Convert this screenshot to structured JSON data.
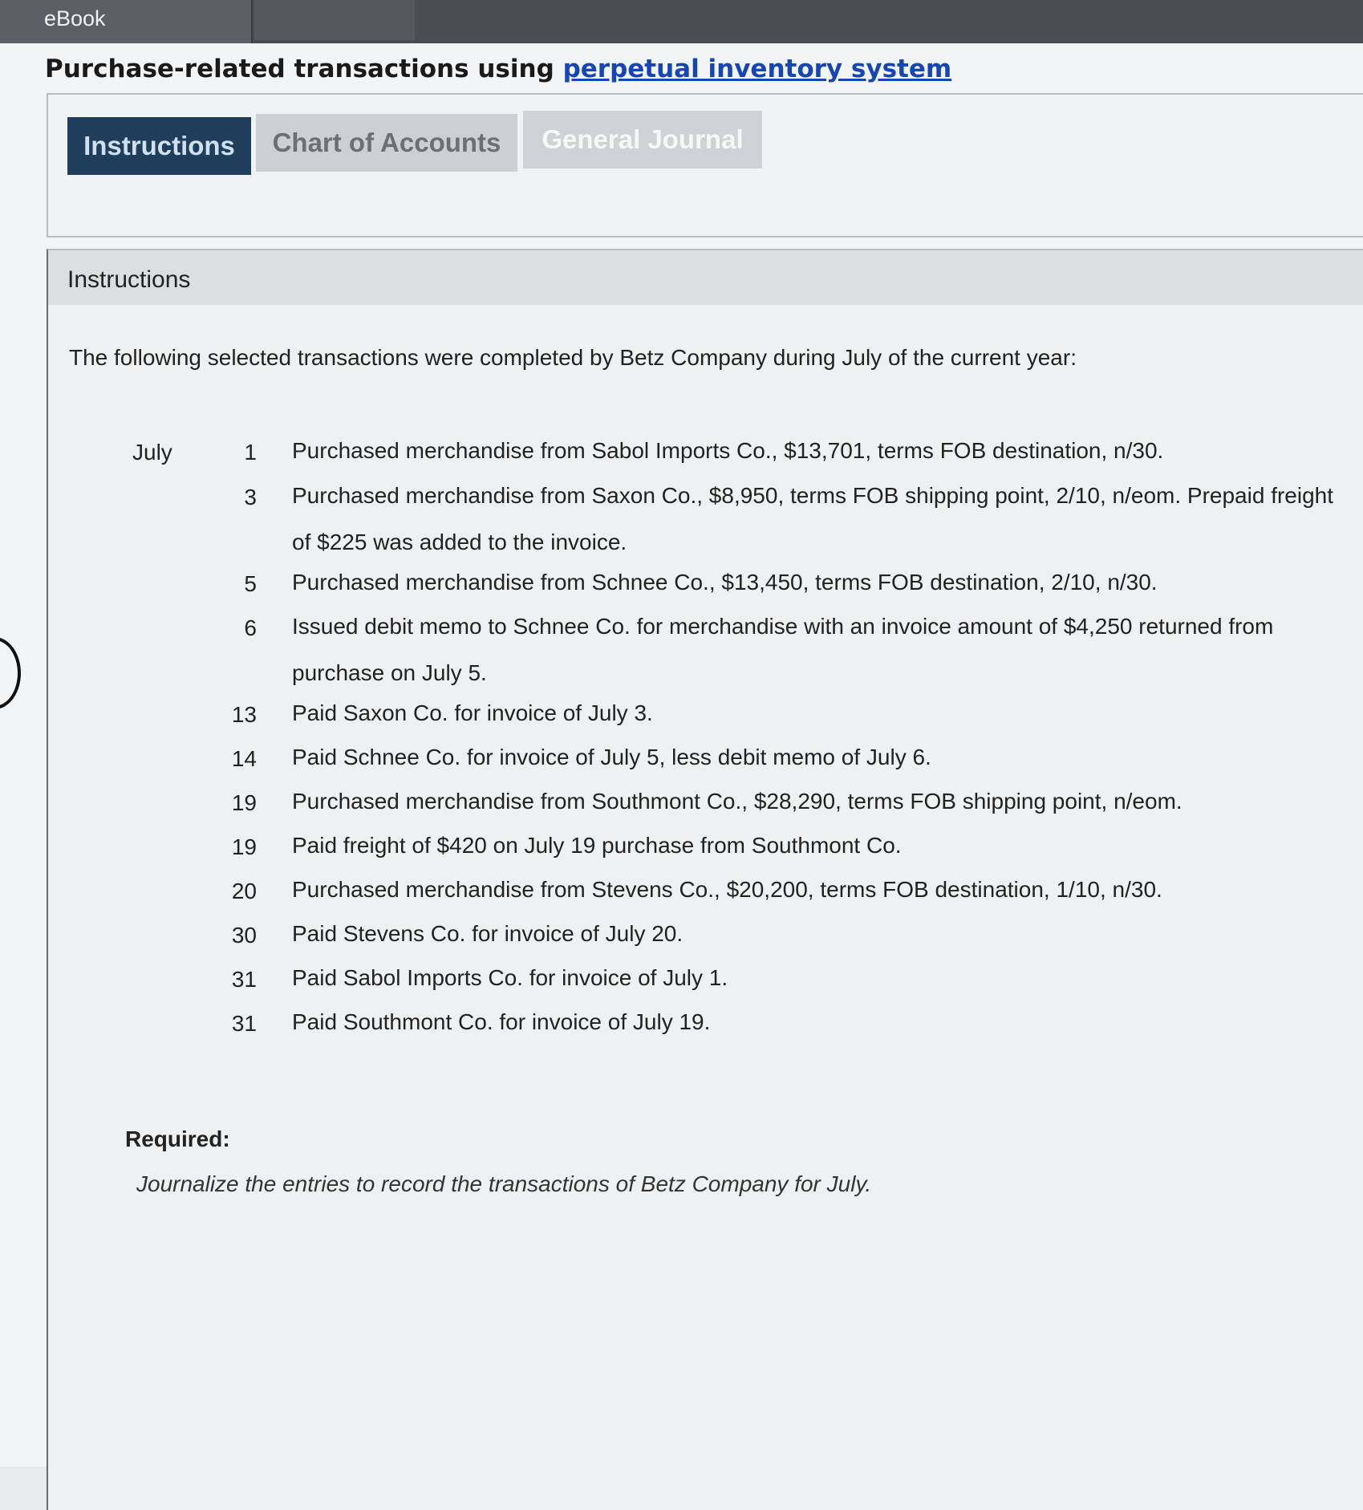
{
  "header": {
    "ebook_label": "eBook"
  },
  "title": {
    "prefix": "Purchase-related transactions using ",
    "link": "perpetual inventory system"
  },
  "tabs": [
    {
      "label": "Instructions",
      "active": true
    },
    {
      "label": "Chart of Accounts",
      "active": false
    },
    {
      "label": "General Journal",
      "active": false
    }
  ],
  "content": {
    "heading": "Instructions",
    "intro": "The following selected transactions were completed by Betz Company during July of the current year:",
    "month": "July",
    "transactions": [
      {
        "day": "1",
        "text": "Purchased merchandise from Sabol Imports Co., $13,701, terms FOB destination, n/30."
      },
      {
        "day": "3",
        "text": "Purchased merchandise from Saxon Co., $8,950, terms FOB shipping point, 2/10, n/eom. Prepaid freight of $225 was added to the invoice."
      },
      {
        "day": "5",
        "text": "Purchased merchandise from Schnee Co., $13,450, terms FOB destination, 2/10, n/30."
      },
      {
        "day": "6",
        "text": "Issued debit memo to Schnee Co. for merchandise with an invoice amount of $4,250 returned from purchase on July 5."
      },
      {
        "day": "13",
        "text": "Paid Saxon Co. for invoice of July 3."
      },
      {
        "day": "14",
        "text": "Paid Schnee Co. for invoice of July 5, less debit memo of July 6."
      },
      {
        "day": "19",
        "text": "Purchased merchandise from Southmont Co., $28,290, terms FOB shipping point, n/eom."
      },
      {
        "day": "19",
        "text": "Paid freight of $420 on July 19 purchase from Southmont Co."
      },
      {
        "day": "20",
        "text": "Purchased merchandise from Stevens Co., $20,200, terms FOB destination, 1/10, n/30."
      },
      {
        "day": "30",
        "text": "Paid Stevens Co. for invoice of July 20."
      },
      {
        "day": "31",
        "text": "Paid Sabol Imports Co. for invoice of July 1."
      },
      {
        "day": "31",
        "text": "Paid Southmont Co. for invoice of July 19."
      }
    ],
    "required_label": "Required:",
    "required_text": "Journalize the entries to record the transactions of Betz Company for July."
  }
}
